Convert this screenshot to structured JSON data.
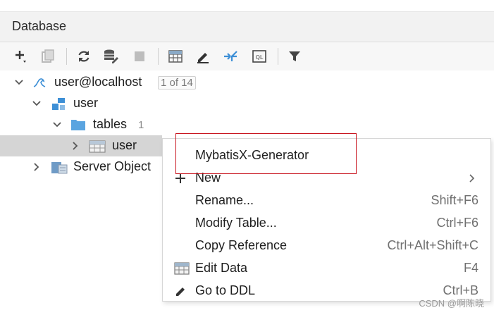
{
  "header": {
    "title": "Database"
  },
  "toolbar": {
    "buttons": [
      {
        "name": "add-icon"
      },
      {
        "name": "duplicate-icon"
      },
      {
        "name": "refresh-icon"
      },
      {
        "name": "db-properties-icon"
      },
      {
        "name": "stop-icon"
      },
      {
        "name": "table-view-icon"
      },
      {
        "name": "edit-icon"
      },
      {
        "name": "jump-icon"
      },
      {
        "name": "console-icon"
      },
      {
        "name": "filter-icon"
      }
    ]
  },
  "tree": {
    "connection": {
      "label": "user@localhost",
      "badge": "1 of 14"
    },
    "schema": {
      "label": "user"
    },
    "tables": {
      "label": "tables",
      "count": "1"
    },
    "table": {
      "label": "user"
    },
    "server": {
      "label": "Server Object"
    }
  },
  "menu": {
    "items": [
      {
        "label": "MybatisX-Generator",
        "shortcut": ""
      },
      {
        "label": "New",
        "shortcut": ""
      },
      {
        "label": "Rename...",
        "shortcut": "Shift+F6"
      },
      {
        "label": "Modify Table...",
        "shortcut": "Ctrl+F6"
      },
      {
        "label": "Copy Reference",
        "shortcut": "Ctrl+Alt+Shift+C"
      },
      {
        "label": "Edit Data",
        "shortcut": "F4"
      },
      {
        "label": "Go to DDL",
        "shortcut": "Ctrl+B"
      }
    ]
  },
  "colors": {
    "accent": "#3d8fd6",
    "highlight": "#c8141e",
    "selection": "#d5d5d5"
  },
  "watermark": "CSDN @啊陈晓"
}
